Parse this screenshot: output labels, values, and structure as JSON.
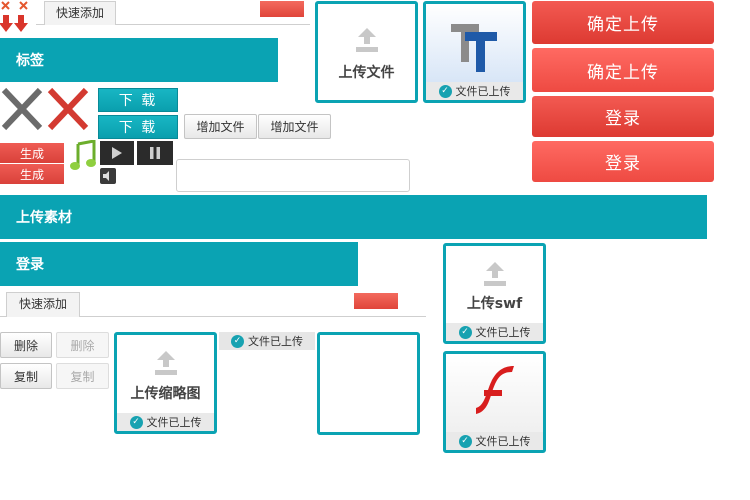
{
  "tabs": {
    "top_tab": "快速添加",
    "mid_tab": "快速添加"
  },
  "headers": {
    "tag": "标签",
    "upload_material": "上传素材",
    "login": "登录"
  },
  "buttons": {
    "download_1": "下 载",
    "download_2": "下 载",
    "add_file_1": "增加文件",
    "add_file_2": "增加文件",
    "generate_1": "生成",
    "generate_2": "生成",
    "confirm_upload_1": "确定上传",
    "confirm_upload_2": "确定上传",
    "login_1": "登录",
    "login_2": "登录",
    "delete": "删除",
    "delete_disabled": "删除",
    "copy": "复制",
    "copy_disabled": "复制"
  },
  "cards": {
    "upload_file": "上传文件",
    "font_file_done": "文件已上传",
    "upload_swf": "上传swf",
    "upload_swf_done": "文件已上传",
    "upload_thumbnail": "上传缩略图",
    "thumbnail_done": "文件已上传",
    "flash_done": "文件已上传",
    "floating_done": "文件已上传"
  },
  "input": {
    "value": "",
    "placeholder": ""
  },
  "icons": {
    "delete_x": "close-icon",
    "download_arrows": "arrow-down-icon",
    "music": "music-note-icon",
    "play": "play-icon",
    "pause": "pause-icon",
    "volume": "speaker-icon",
    "upload": "upload-icon",
    "font": "font-tt-icon",
    "flash": "flash-icon"
  },
  "colors": {
    "teal": "#0aa3b3",
    "red": "#e0453a",
    "grey_button": "#e8e8e8"
  }
}
